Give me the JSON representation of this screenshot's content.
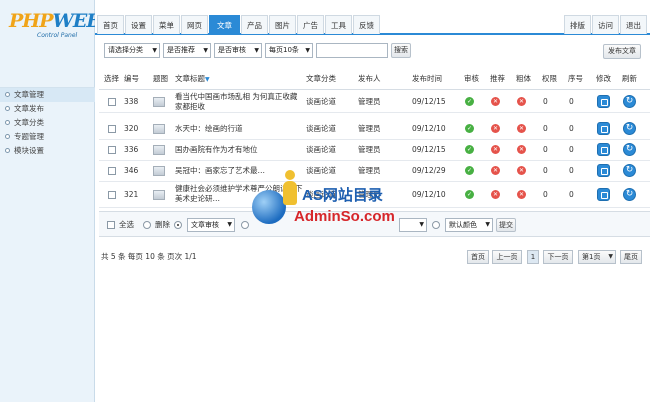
{
  "logo": {
    "word1": "PHP",
    "word2": "WEB",
    "sub": "Control Panel"
  },
  "sidebar": {
    "items": [
      {
        "label": "文章管理",
        "active": true
      },
      {
        "label": "文章发布",
        "active": false
      },
      {
        "label": "文章分类",
        "active": false
      },
      {
        "label": "专题管理",
        "active": false
      },
      {
        "label": "模块设置",
        "active": false
      }
    ]
  },
  "topnav": {
    "tabs": [
      "首页",
      "设置",
      "菜单",
      "网页",
      "文章",
      "产品",
      "图片",
      "广告",
      "工具",
      "反馈"
    ],
    "active_tab": "文章",
    "right": [
      "排版",
      "访问",
      "退出"
    ]
  },
  "filter": {
    "category": "请选择分类",
    "recommend": "是否推荐",
    "audit": "是否审核",
    "per_page": "每页10条",
    "search_value": "",
    "search_button": "搜索",
    "publish_button": "发布文章"
  },
  "table": {
    "headers": [
      "选择",
      "编号",
      "题图",
      "文章标题",
      "文章分类",
      "发布人",
      "发布时间",
      "审核",
      "推荐",
      "粗体",
      "权限",
      "序号",
      "修改",
      "刷新"
    ],
    "title_sort_icon": "sort-arrow-icon",
    "rows": [
      {
        "id": "338",
        "title": "看当代中国画市场乱相 为何真正收藏家都拒收",
        "category": "谈画论道",
        "author": "管理员",
        "date": "09/12/15",
        "audit": true,
        "recommend": false,
        "bold": false,
        "perm": "0",
        "order": "0"
      },
      {
        "id": "320",
        "title": "水天中：绘画的行道",
        "category": "谈画论道",
        "author": "管理员",
        "date": "09/12/10",
        "audit": true,
        "recommend": false,
        "bold": false,
        "perm": "0",
        "order": "0"
      },
      {
        "id": "336",
        "title": "国办画院有作为才有地位",
        "category": "谈画论道",
        "author": "管理员",
        "date": "09/12/15",
        "audit": true,
        "recommend": false,
        "bold": false,
        "perm": "0",
        "order": "0"
      },
      {
        "id": "346",
        "title": "吴冠中：画家忘了艺术最…",
        "category": "谈画论道",
        "author": "管理员",
        "date": "09/12/29",
        "audit": true,
        "recommend": false,
        "bold": false,
        "perm": "0",
        "order": "0"
      },
      {
        "id": "321",
        "title": "健康社会必须维护学术尊严公朗读当下美术史论研…",
        "category": "谈画论道",
        "author": "管理员",
        "date": "09/12/10",
        "audit": true,
        "recommend": false,
        "bold": false,
        "perm": "0",
        "order": "0"
      }
    ]
  },
  "actions": {
    "select_all": "全选",
    "delete": "删除",
    "audit_select": "文章审核",
    "color_select": "默认颜色",
    "submit": "提交"
  },
  "pagination": {
    "info": "共 5 条 每页 10 条 页次 1/1",
    "first": "首页",
    "prev": "上一页",
    "current": "1",
    "next": "下一页",
    "jump": "第1页",
    "last": "尾页"
  },
  "watermark": {
    "line1": "AS网站目录",
    "line2": "AdminSo.com"
  },
  "colors": {
    "accent": "#2b8ad6",
    "ok": "#48b043",
    "no": "#e5534b",
    "sidebar_bg": "#eaf3fa"
  }
}
